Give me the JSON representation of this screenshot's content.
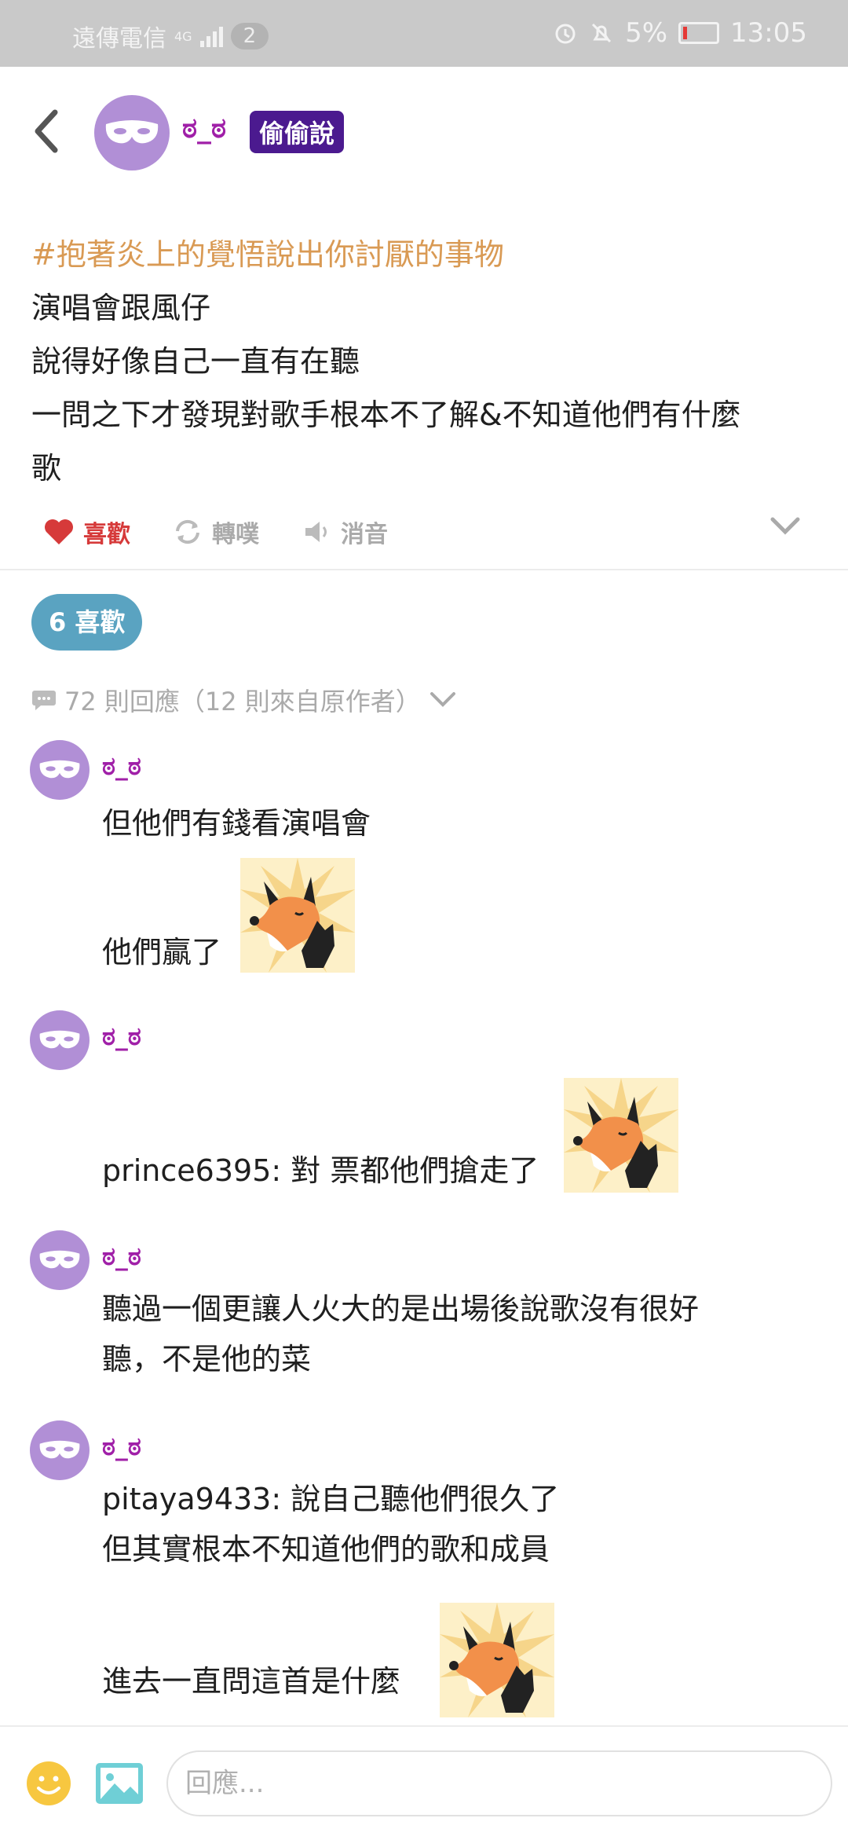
{
  "status_bar": {
    "carrier": "遠傳電信",
    "network": "4G",
    "notification_count": "2",
    "battery": "5%",
    "time": "13:05"
  },
  "header": {
    "author": "ಠ_ಠ",
    "tag": "偷偷說"
  },
  "post": {
    "hashtag": "#抱著炎上的覺悟說出你討厭的事物",
    "lines": [
      "演唱會跟風仔",
      "說得好像自己一直有在聽",
      "一問之下才發現對歌手根本不了解&不知道他們有什麼",
      "歌"
    ]
  },
  "actions": {
    "like": "喜歡",
    "share": "轉噗",
    "mute": "消音"
  },
  "likes_badge": "6 喜歡",
  "reply_summary": "72 則回應（12 則來自原作者）",
  "comments": [
    {
      "author": "ಠ_ಠ",
      "lines": [
        "但他們有錢看演唱會",
        "他們贏了"
      ]
    },
    {
      "author": "ಠ_ಠ",
      "lines": [
        "prince6395: 對 票都他們搶走了"
      ]
    },
    {
      "author": "ಠ_ಠ",
      "lines": [
        "聽過一個更讓人火大的是出場後說歌沒有很好",
        "聽，不是他的菜"
      ]
    },
    {
      "author": "ಠ_ಠ",
      "lines": [
        "pitaya9433: 說自己聽他們很久了",
        "但其實根本不知道他們的歌和成員",
        "進去一直問這首是什麼"
      ]
    }
  ],
  "composer": {
    "placeholder": "回應..."
  },
  "colors": {
    "avatar": "#b18fd6",
    "username": "#a020a8",
    "tag_bg": "#4b1a8f",
    "hashtag": "#d99a54",
    "like_red": "#d63a3a",
    "likes_badge": "#5aa3c1"
  }
}
